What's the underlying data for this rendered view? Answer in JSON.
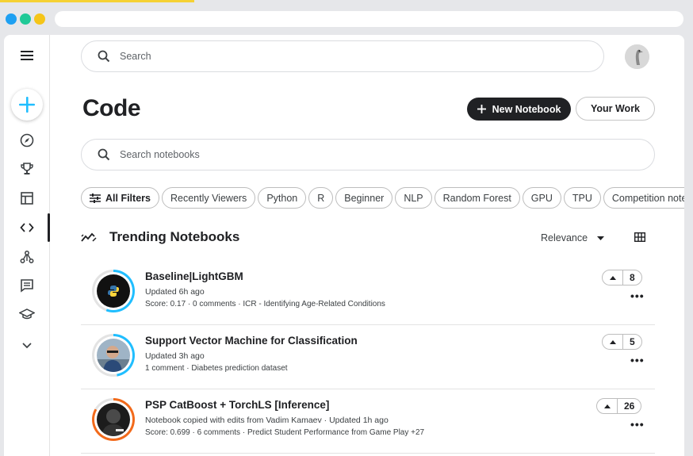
{
  "window": {
    "dot_colors": [
      "#1ea0f2",
      "#20c997",
      "#f5c518"
    ],
    "accent_color": "#f5d134"
  },
  "sidebar": {
    "items": [
      {
        "icon": "menu-icon"
      },
      {
        "icon": "plus-icon"
      },
      {
        "icon": "compass-icon"
      },
      {
        "icon": "trophy-icon"
      },
      {
        "icon": "table-icon"
      },
      {
        "icon": "code-icon",
        "active": true
      },
      {
        "icon": "models-icon"
      },
      {
        "icon": "discussion-icon"
      },
      {
        "icon": "learn-icon"
      },
      {
        "icon": "chevron-down-icon"
      }
    ]
  },
  "header": {
    "search_placeholder": "Search",
    "avatar_icon": "ostrich-avatar"
  },
  "page": {
    "title": "Code",
    "new_notebook_label": "New Notebook",
    "your_work_label": "Your Work",
    "notebook_search_placeholder": "Search notebooks"
  },
  "filters": {
    "all_filters_label": "All Filters",
    "chips": [
      "Recently Viewers",
      "Python",
      "R",
      "Beginner",
      "NLP",
      "Random Forest",
      "GPU",
      "TPU",
      "Competition notebook"
    ]
  },
  "trending": {
    "title": "Trending Notebooks",
    "sort_label": "Relevance",
    "icon": "trending-icon",
    "notebooks": [
      {
        "title": "Baseline|LightGBM",
        "updated": "Updated 6h ago",
        "meta": "Score: 0.17 · 0 comments · ICR - Identifying Age-Related Conditions",
        "votes": "8",
        "ring_color": "#20beff"
      },
      {
        "title": "Support Vector Machine for Classification",
        "updated": "Updated 3h ago",
        "meta": "1 comment · Diabetes prediction dataset",
        "votes": "5",
        "ring_color": "#20beff"
      },
      {
        "title": "PSP CatBoost + TorchLS [Inference]",
        "updated": "Notebook copied with edits from Vadim Kamaev · Updated 1h ago",
        "meta": "Score: 0.699 · 6 comments · Predict Student Performance from Game Play +27",
        "votes": "26",
        "ring_color": "#f26a1b"
      }
    ]
  }
}
